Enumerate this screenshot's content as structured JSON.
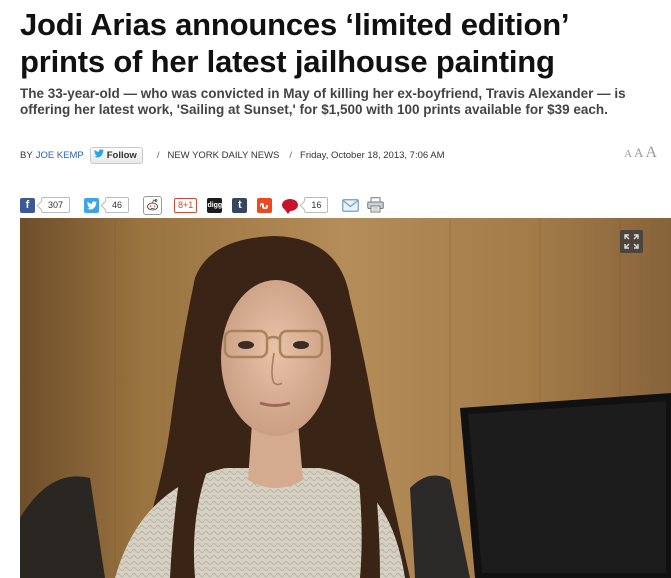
{
  "article": {
    "headline": "Jodi Arias announces ‘limited edition’ prints of her latest jailhouse painting",
    "dek": "The 33-year-old — who was convicted in May of killing her ex-boyfriend, Travis Alexander — is offering her latest work, 'Sailing at Sunset,' for $1,500 with 100 prints available for $39 each."
  },
  "byline": {
    "by_text": "BY",
    "author": "JOE KEMP",
    "follow_label": "Follow",
    "separator": "/",
    "source": "NEW YORK DAILY NEWS",
    "date": "Friday, October 18, 2013, 7:06 AM"
  },
  "text_size": {
    "small": "A",
    "medium": "A",
    "large": "A"
  },
  "social": {
    "facebook_count": "307",
    "twitter_count": "46",
    "gplus_label": "8+1",
    "digg_label": "digg",
    "tumblr_label": "t",
    "comments_count": "16"
  },
  "icons": {
    "facebook": "facebook-icon",
    "twitter": "twitter-icon",
    "reddit": "reddit-icon",
    "gplus": "google-plus-icon",
    "digg": "digg-icon",
    "tumblr": "tumblr-icon",
    "stumbleupon": "stumbleupon-icon",
    "comments": "comment-icon",
    "email": "email-icon",
    "print": "print-icon",
    "expand": "expand-icon"
  },
  "colors": {
    "author_link": "#2a64b0",
    "facebook": "#3b5998",
    "twitter": "#3aa6e6",
    "comments": "#c8142a",
    "stumbleupon": "#eb4924"
  }
}
